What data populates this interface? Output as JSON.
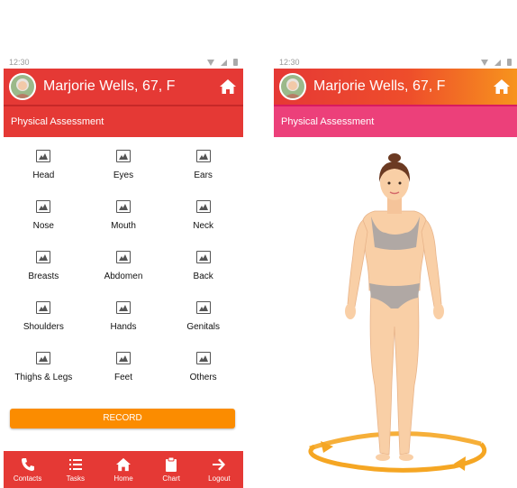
{
  "left": {
    "status": {
      "time": "12:30"
    },
    "header": {
      "name": "Marjorie Wells,",
      "meta": "67, F"
    },
    "subheader": "Physical Assessment",
    "body_parts": [
      "Head",
      "Eyes",
      "Ears",
      "Nose",
      "Mouth",
      "Neck",
      "Breasts",
      "Abdomen",
      "Back",
      "Shoulders",
      "Hands",
      "Genitals",
      "Thighs & Legs",
      "Feet",
      "Others"
    ],
    "record_label": "RECORD",
    "nav": [
      {
        "icon": "phone-icon",
        "label": "Contacts"
      },
      {
        "icon": "list-icon",
        "label": "Tasks"
      },
      {
        "icon": "home-icon",
        "label": "Home"
      },
      {
        "icon": "clipboard-icon",
        "label": "Chart"
      },
      {
        "icon": "arrow-right-icon",
        "label": "Logout"
      }
    ]
  },
  "right": {
    "status": {
      "time": "12:30"
    },
    "header": {
      "name": "Marjorie Wells,",
      "meta": "67, F"
    },
    "subheader": "Physical Assessment"
  },
  "colors": {
    "primary": "#e53935",
    "accent": "#fb8c00",
    "pink": "#ec407a",
    "skin": "#f9cfa6",
    "underwear": "#b0a8a4",
    "rotate_arrow": "#f5a623"
  }
}
